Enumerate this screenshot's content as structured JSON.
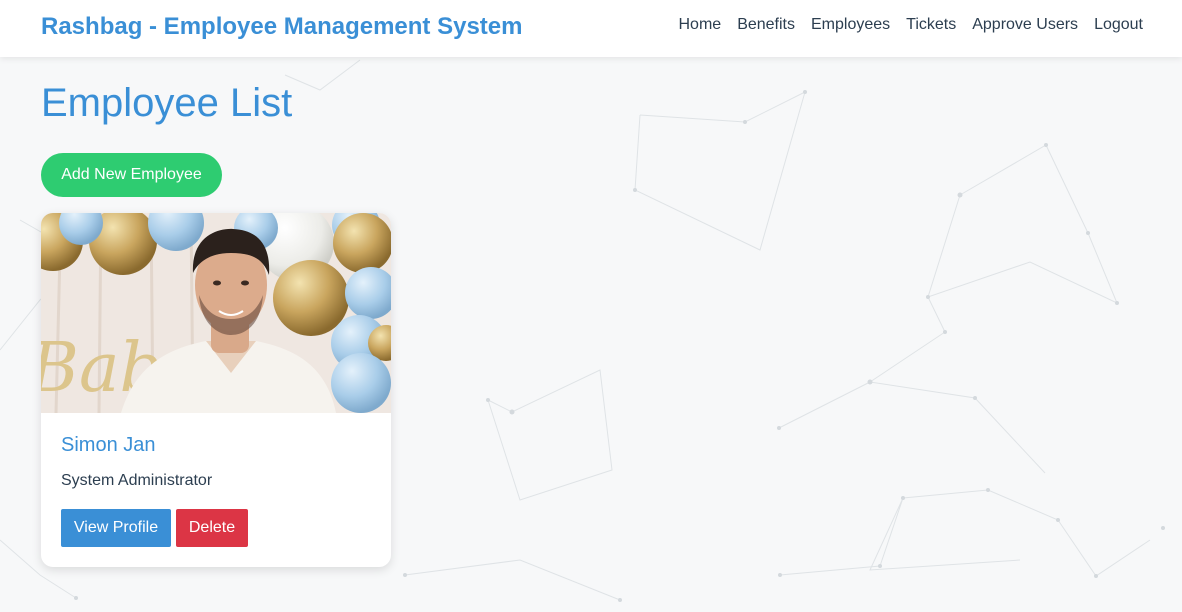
{
  "navbar": {
    "brand": "Rashbag - Employee Management System",
    "links": [
      {
        "label": "Home"
      },
      {
        "label": "Benefits"
      },
      {
        "label": "Employees"
      },
      {
        "label": "Tickets"
      },
      {
        "label": "Approve Users"
      },
      {
        "label": "Logout"
      }
    ]
  },
  "main": {
    "title": "Employee List",
    "add_button_label": "Add New Employee",
    "employees": [
      {
        "name": "Simon Jan",
        "role": "System Administrator",
        "photo_alt": "employee-photo",
        "photo_text": "Baby",
        "view_label": "View Profile",
        "delete_label": "Delete"
      }
    ]
  },
  "colors": {
    "accent": "#3a8fd6",
    "success": "#2ecc71",
    "danger": "#dc3545",
    "text": "#2c3e50"
  }
}
